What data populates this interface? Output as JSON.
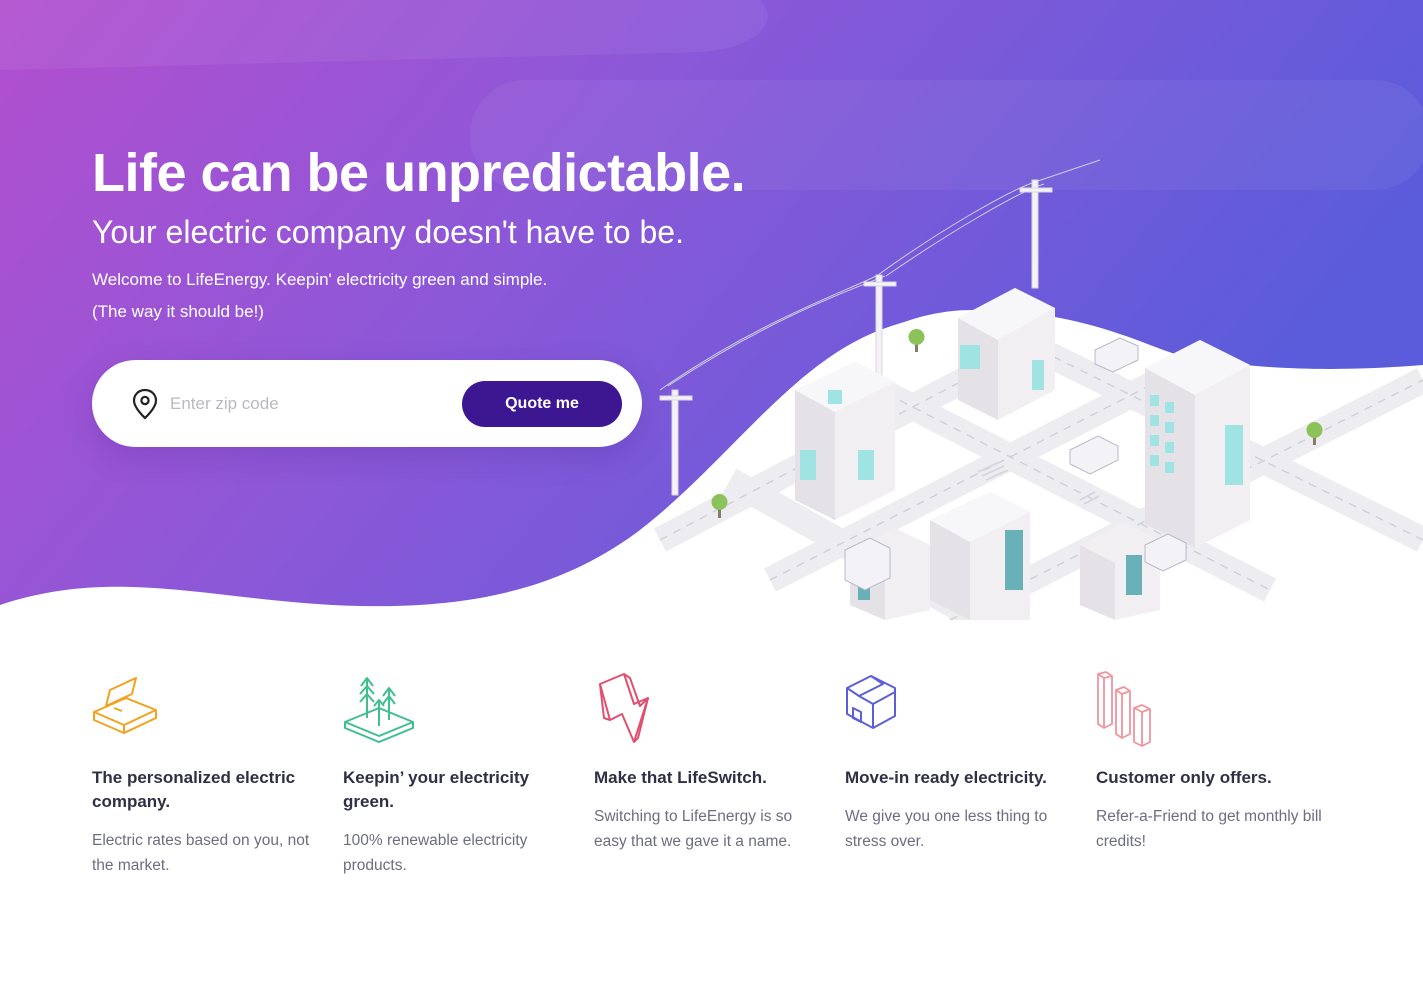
{
  "hero": {
    "title": "Life can be unpredictable.",
    "subtitle": "Your electric company doesn't have to be.",
    "welcome": "Welcome to LifeEnergy. Keepin' electricity green and simple.",
    "tagline": "(The way it should be!)",
    "gradient_start": "#b14fd0",
    "gradient_end": "#5b5bdc"
  },
  "zip_form": {
    "placeholder": "Enter zip code",
    "value": "",
    "button_label": "Quote me",
    "button_color": "#3c1791",
    "icon": "map-pin-icon"
  },
  "illustration": {
    "icon": "isometric-city-icon"
  },
  "features": [
    {
      "icon": "package-box-icon",
      "icon_color": "#f2a21e",
      "title": "The personalized electric company.",
      "description": "Electric rates based on you, not the market."
    },
    {
      "icon": "green-trees-icon",
      "icon_color": "#3fbf8f",
      "title": "Keepin’ your electricity green.",
      "description": "100% renewable electricity products."
    },
    {
      "icon": "lightning-bolt-icon",
      "icon_color": "#e0506e",
      "title": "Make that LifeSwitch.",
      "description": "Switching to LifeEnergy is so easy that we gave it a name."
    },
    {
      "icon": "house-icon",
      "icon_color": "#5c5fd6",
      "title": "Move-in ready electricity.",
      "description": "We give you one less thing to stress over."
    },
    {
      "icon": "buildings-icon",
      "icon_color": "#f0949e",
      "title": "Customer only offers.",
      "description": "Refer-a-Friend to get monthly bill credits!"
    }
  ]
}
